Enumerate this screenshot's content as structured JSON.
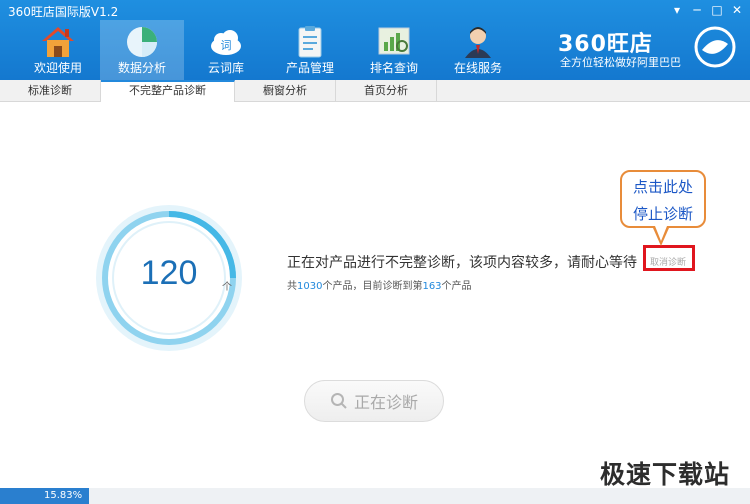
{
  "window": {
    "title": "360旺店国际版V1.2",
    "controls": [
      "▾",
      "─",
      "□",
      "✕"
    ]
  },
  "nav": {
    "items": [
      {
        "label": "欢迎使用",
        "icon": "home-icon",
        "active": false
      },
      {
        "label": "数据分析",
        "icon": "pie-chart-icon",
        "active": true
      },
      {
        "label": "云词库",
        "icon": "cloud-word-icon",
        "active": false
      },
      {
        "label": "产品管理",
        "icon": "clipboard-icon",
        "active": false
      },
      {
        "label": "排名查询",
        "icon": "ranking-icon",
        "active": false
      },
      {
        "label": "在线服务",
        "icon": "support-agent-icon",
        "active": false
      }
    ]
  },
  "logo": {
    "text": "360旺店",
    "subtitle": "全方位轻松做好阿里巴巴"
  },
  "tabs": [
    {
      "label": "标准诊断",
      "active": false
    },
    {
      "label": "不完整产品诊断",
      "active": true
    },
    {
      "label": "橱窗分析",
      "active": false
    },
    {
      "label": "首页分析",
      "active": false
    }
  ],
  "gauge": {
    "value": "120",
    "unit": "个"
  },
  "status": {
    "main": "正在对产品进行不完整诊断，该项内容较多，请耐心等待",
    "sub_prefix": "共",
    "total": "1030",
    "sub_mid": "个产品，目前诊断到第",
    "current": "163",
    "sub_suffix": "个产品"
  },
  "cancel": {
    "label": "取消诊断"
  },
  "callout": {
    "line1": "点击此处",
    "line2": "停止诊断"
  },
  "diagnose_button": {
    "label": "正在诊断"
  },
  "watermark": "极速下载站",
  "progress": {
    "percent_text": "15.83%",
    "fraction": 0.1583
  },
  "colors": {
    "header_blue": "#1478cf",
    "accent_blue": "#2389dc",
    "callout_border": "#e88c3a",
    "cancel_border": "#e0161e"
  }
}
